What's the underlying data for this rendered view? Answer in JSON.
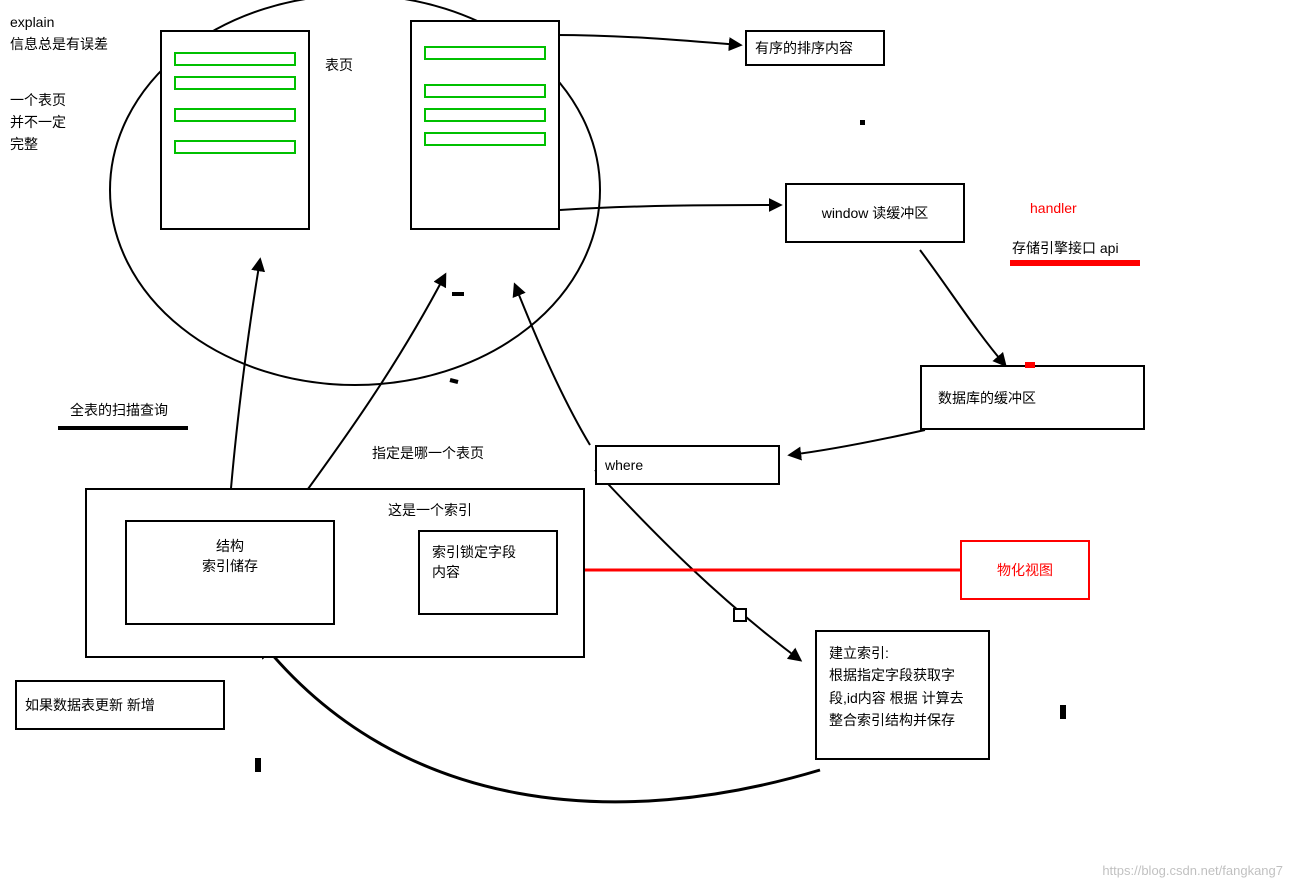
{
  "notes": {
    "explain_title": "explain",
    "explain_line1": "信息总是有误差",
    "explain_line2": "一个表页",
    "explain_line3": "并不一定",
    "explain_line4": "完整"
  },
  "labels": {
    "table_page": "表页",
    "specify_page": "指定是哪一个表页",
    "where": "where",
    "full_scan": "全表的扫描查询",
    "this_is_index": "这是一个索引",
    "struct_line1": "结构",
    "struct_line2": "索引储存",
    "index_lock_line1": "索引锁定字段",
    "index_lock_line2": "内容",
    "update_note": "如果数据表更新 新增",
    "sorted_content": "有序的排序内容",
    "window_buffer": "window 读缓冲区",
    "handler": "handler",
    "storage_api": "存储引擎接口 api",
    "db_buffer": "数据库的缓冲区",
    "build_idx_line1": "建立索引:",
    "build_idx_line2": "根据指定字段获取字",
    "build_idx_line3": "段,id内容 根据 计算去",
    "build_idx_line4": "整合索引结构并保存",
    "materialized": "物化视图"
  },
  "watermark": "https://blog.csdn.net/fangkang7"
}
